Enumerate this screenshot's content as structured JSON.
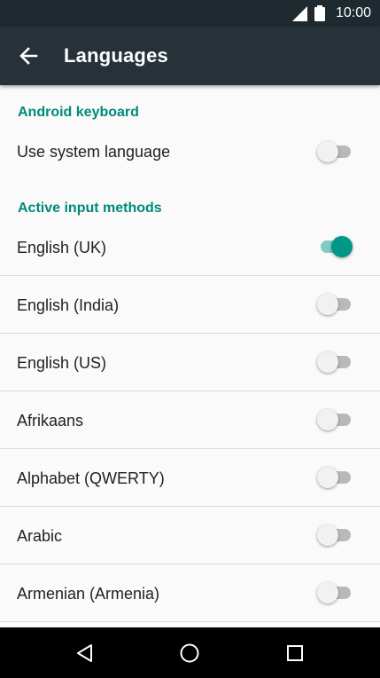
{
  "status_bar": {
    "time": "10:00"
  },
  "app_bar": {
    "title": "Languages"
  },
  "sections": {
    "android_keyboard": {
      "header": "Android keyboard",
      "use_system_language": {
        "label": "Use system language",
        "enabled": false
      }
    },
    "active_input_methods": {
      "header": "Active input methods",
      "items": [
        {
          "label": "English (UK)",
          "enabled": true
        },
        {
          "label": "English (India)",
          "enabled": false
        },
        {
          "label": "English (US)",
          "enabled": false
        },
        {
          "label": "Afrikaans",
          "enabled": false
        },
        {
          "label": "Alphabet (QWERTY)",
          "enabled": false
        },
        {
          "label": "Arabic",
          "enabled": false
        },
        {
          "label": "Armenian (Armenia)",
          "enabled": false
        }
      ]
    }
  },
  "colors": {
    "accent": "#009688",
    "app_bar": "#263238",
    "status_bar": "#1f2a30"
  },
  "icons": {
    "back": "arrow-back-icon",
    "nav_back": "triangle-back-icon",
    "nav_home": "circle-home-icon",
    "nav_recents": "square-recents-icon"
  }
}
